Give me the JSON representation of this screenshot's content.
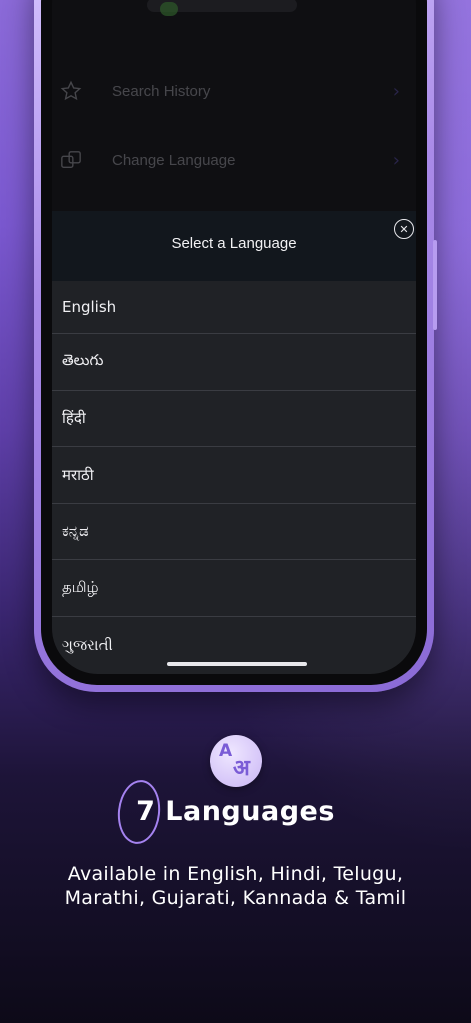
{
  "menu": {
    "items": [
      {
        "label": "Search History",
        "icon": "star-icon"
      },
      {
        "label": "Change Language",
        "icon": "language-icon"
      }
    ]
  },
  "sheet": {
    "title": "Select a Language",
    "close_icon": "close-icon"
  },
  "languages": [
    "English",
    "తెలుగు",
    "हिंदी",
    "मराठी",
    "ಕನ್ನಡ",
    "தமிழ்",
    "ગુજરાતી"
  ],
  "feature": {
    "icon": "translate-icon",
    "icon_glyph_a": "A",
    "icon_glyph_b": "अ",
    "count": "7",
    "title": "Languages",
    "subtitle_line1": "Available in English, Hindi, Telugu,",
    "subtitle_line2": "Marathi, Gujarati, Kannada & Tamil"
  },
  "colors": {
    "accent": "#7a5cd6",
    "phone_frame": "#a98ae8",
    "sheet_bg": "#202226"
  }
}
